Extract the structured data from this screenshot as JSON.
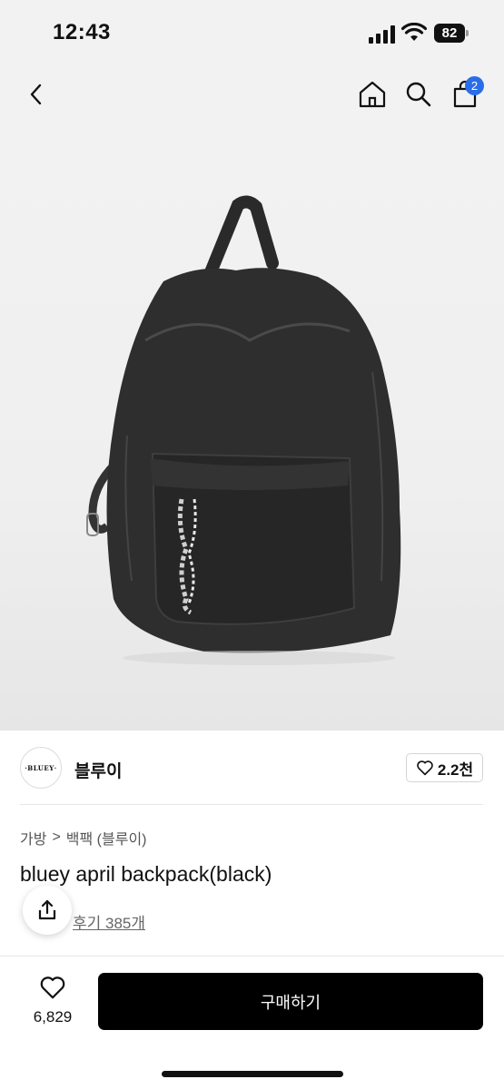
{
  "status_bar": {
    "time": "12:43",
    "battery": "82"
  },
  "nav": {
    "cart_count": "2"
  },
  "brand": {
    "logo_text": "·BLUEY·",
    "name": "블루이",
    "likes": "2.2천"
  },
  "breadcrumb": {
    "category": "가방",
    "separator": ">",
    "subcategory": "백팩 (블루이)"
  },
  "product": {
    "title": "bluey april backpack(black)",
    "reviews": "후기 385개"
  },
  "bottom_bar": {
    "wish_count": "6,829",
    "buy_label": "구매하기"
  },
  "colors": {
    "accent": "#2b6de8",
    "buy_button": "#000000",
    "bag": "#2e2e2e"
  }
}
